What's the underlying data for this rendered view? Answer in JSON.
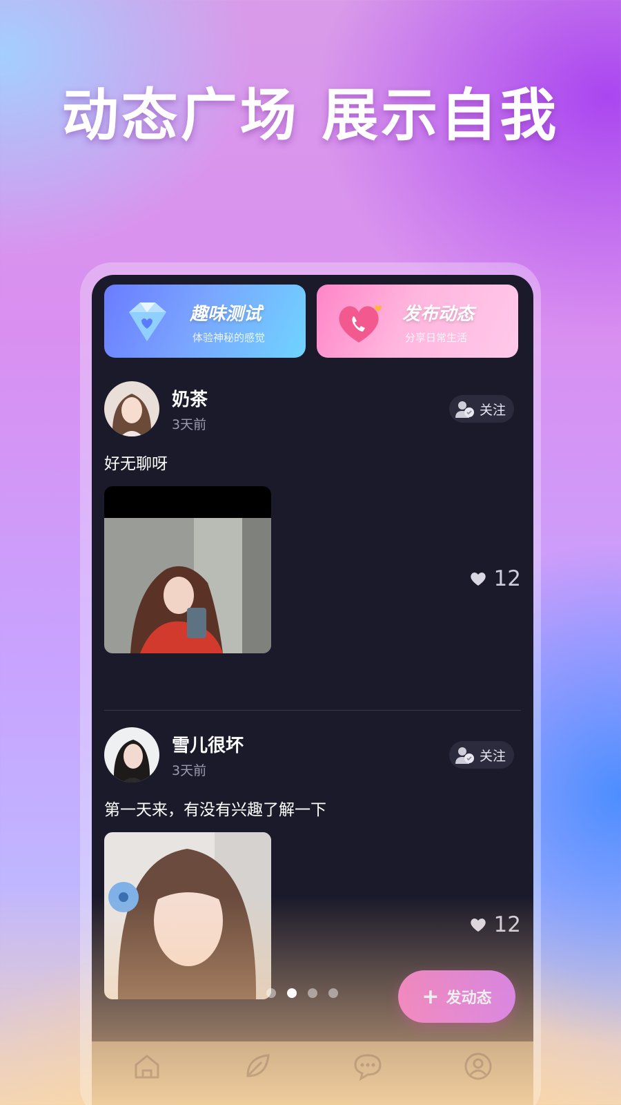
{
  "promo": {
    "headline": "动态广场  展示自我"
  },
  "cards": [
    {
      "title": "趣味测试",
      "subtitle": "体验神秘的感觉",
      "icon": "diamond-icon"
    },
    {
      "title": "发布动态",
      "subtitle": "分享日常生活",
      "icon": "heart-phone-icon"
    }
  ],
  "posts": [
    {
      "username": "奶茶",
      "time": "3天前",
      "follow_label": "关注",
      "text": "好无聊呀",
      "likes": "12"
    },
    {
      "username": "雪儿很坏",
      "time": "3天前",
      "follow_label": "关注",
      "text": "第一天来，有没有兴趣了解一下",
      "likes": "12"
    }
  ],
  "carousel": {
    "page_count": 4,
    "active_index": 1
  },
  "fab": {
    "icon": "plus-icon",
    "label": "发动态"
  },
  "tabbar": {
    "items": [
      "home-icon",
      "leaf-icon",
      "chat-icon",
      "profile-icon"
    ]
  },
  "colors": {
    "screen_bg": "#1b1a2b",
    "accent_pink": "#ff85c8",
    "accent_blue": "#6a7cff"
  }
}
